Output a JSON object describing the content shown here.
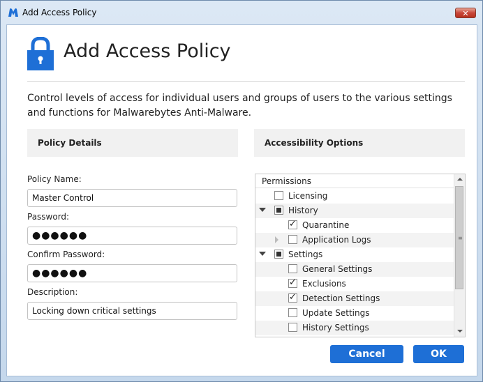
{
  "window": {
    "title": "Add Access Policy",
    "close_glyph": "✕"
  },
  "header": {
    "title": "Add Access Policy",
    "icon": "lock-icon"
  },
  "intro": "Control levels of access for individual users and groups of users to the various settings and functions for Malwarebytes Anti-Malware.",
  "policy_details": {
    "heading": "Policy Details",
    "name_label": "Policy Name:",
    "name_value": "Master Control",
    "password_label": "Password:",
    "password_value": "●●●●●●",
    "confirm_label": "Confirm Password:",
    "confirm_value": "●●●●●●",
    "description_label": "Description:",
    "description_value": "Locking down critical settings"
  },
  "accessibility": {
    "heading": "Accessibility Options",
    "tree_header": "Permissions",
    "items": [
      {
        "label": "Licensing",
        "state": "unchecked"
      },
      {
        "label": "History",
        "state": "partial",
        "expanded": true
      },
      {
        "label": "Quarantine",
        "state": "checked"
      },
      {
        "label": "Application Logs",
        "state": "unchecked",
        "expanded": false
      },
      {
        "label": "Settings",
        "state": "partial",
        "expanded": true
      },
      {
        "label": "General Settings",
        "state": "unchecked"
      },
      {
        "label": "Exclusions",
        "state": "checked"
      },
      {
        "label": "Detection Settings",
        "state": "checked"
      },
      {
        "label": "Update Settings",
        "state": "unchecked"
      },
      {
        "label": "History Settings",
        "state": "unchecked"
      }
    ]
  },
  "buttons": {
    "cancel": "Cancel",
    "ok": "OK"
  },
  "colors": {
    "accent": "#1e6fd6",
    "close": "#c8473a"
  }
}
